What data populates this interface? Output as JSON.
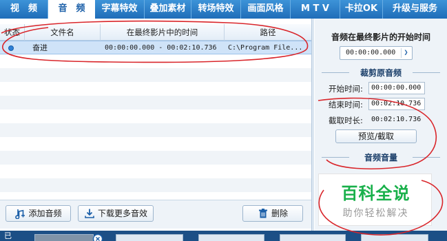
{
  "tabs": [
    {
      "label": "视　频",
      "active": false
    },
    {
      "label": "音　频",
      "active": true
    },
    {
      "label": "字幕特效",
      "active": false
    },
    {
      "label": "叠加素材",
      "active": false
    },
    {
      "label": "转场特效",
      "active": false
    },
    {
      "label": "画面风格",
      "active": false
    },
    {
      "label": "M T V",
      "active": false
    },
    {
      "label": "卡拉OK",
      "active": false
    },
    {
      "label": "升级与服务",
      "active": false
    }
  ],
  "file_list": {
    "columns": [
      "状态",
      "文件名",
      "在最终影片中的时间",
      "路径"
    ],
    "rows": [
      {
        "name": "奋进",
        "time": "00:00:00.000 - 00:02:10.736",
        "path": "C:\\Program File..."
      }
    ]
  },
  "buttons": {
    "add_audio": "添加音频",
    "download_more": "下载更多音效",
    "delete": "删除"
  },
  "panel": {
    "start_title": "音频在最终影片的开始时间",
    "start_time": "00:00:00.000",
    "trim_title": "裁剪原音频",
    "start_label": "开始时间:",
    "start_value": "00:00:00.000",
    "end_label": "结束时间:",
    "end_value": "00:02:10.736",
    "duration_label": "截取时长:",
    "duration_value": "00:02:10.736",
    "preview_button": "预览/截取",
    "volume_title": "音频音量"
  },
  "watermark": {
    "title": "百科全说",
    "subtitle": "助你轻松解决"
  },
  "timeline": {
    "label": "已"
  },
  "colors": {
    "tab_bar": "#2a7dc9",
    "selected_row": "#cfe3f8",
    "annotation": "#d9252a",
    "watermark_green": "#18b04a"
  }
}
